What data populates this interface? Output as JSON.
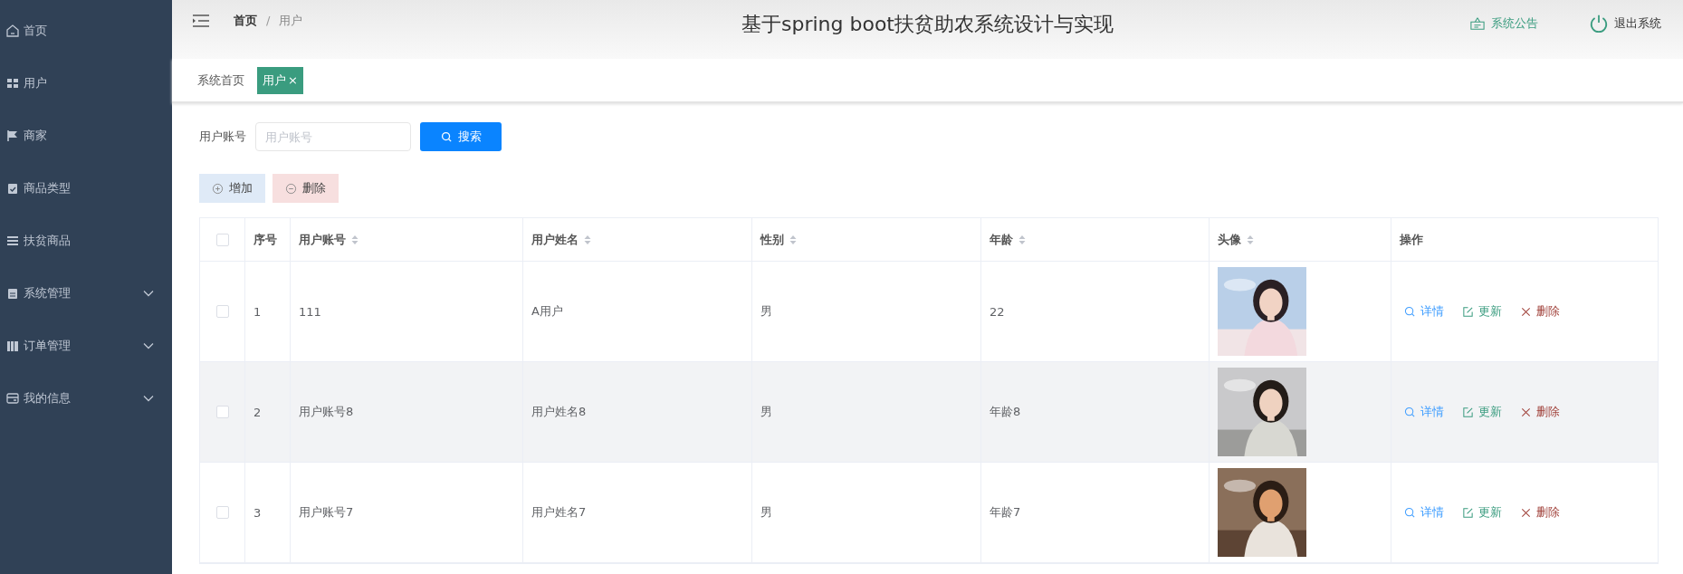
{
  "sidebar": {
    "items": [
      {
        "label": "首页",
        "expandable": false
      },
      {
        "label": "用户",
        "expandable": false
      },
      {
        "label": "商家",
        "expandable": false
      },
      {
        "label": "商品类型",
        "expandable": false
      },
      {
        "label": "扶贫商品",
        "expandable": false
      },
      {
        "label": "系统管理",
        "expandable": true
      },
      {
        "label": "订单管理",
        "expandable": true
      },
      {
        "label": "我的信息",
        "expandable": true
      }
    ]
  },
  "header": {
    "breadcrumb": [
      "首页",
      "用户"
    ],
    "separator": "/",
    "title": "基于spring boot扶贫助农系统设计与实现",
    "actions": [
      {
        "label": "系统公告",
        "kind": "notice"
      },
      {
        "label": "退出系统",
        "kind": "logout"
      }
    ]
  },
  "tabs": [
    {
      "label": "系统首页",
      "selected": false,
      "closable": false
    },
    {
      "label": "用户",
      "selected": true,
      "closable": true,
      "close": "×"
    }
  ],
  "search": {
    "label": "用户账号",
    "placeholder": "用户账号",
    "button": "搜索"
  },
  "toolbar": [
    {
      "label": "增加",
      "kind": "add"
    },
    {
      "label": "删除",
      "kind": "delete"
    }
  ],
  "table": {
    "all_checked": false,
    "columns": [
      {
        "label": "序号",
        "sortable": false
      },
      {
        "label": "用户账号",
        "sortable": true
      },
      {
        "label": "用户姓名",
        "sortable": true
      },
      {
        "label": "性别",
        "sortable": true
      },
      {
        "label": "年龄",
        "sortable": true
      },
      {
        "label": "头像",
        "sortable": true
      },
      {
        "label": "操作",
        "sortable": false
      }
    ],
    "rows": [
      {
        "checked": false,
        "highlighted": false,
        "index": "1",
        "account": "111",
        "name": "A用户",
        "gender": "男",
        "age": "22",
        "actions": [
          {
            "label": "详情",
            "kind": "detail"
          },
          {
            "label": "更新",
            "kind": "edit"
          },
          {
            "label": "删除",
            "kind": "delete"
          }
        ]
      },
      {
        "checked": false,
        "highlighted": true,
        "index": "2",
        "account": "用户账号8",
        "name": "用户姓名8",
        "gender": "男",
        "age": "年龄8",
        "actions": [
          {
            "label": "详情",
            "kind": "detail"
          },
          {
            "label": "更新",
            "kind": "edit"
          },
          {
            "label": "删除",
            "kind": "delete"
          }
        ]
      },
      {
        "checked": false,
        "highlighted": false,
        "index": "3",
        "account": "用户账号7",
        "name": "用户姓名7",
        "gender": "男",
        "age": "年龄7",
        "actions": [
          {
            "label": "详情",
            "kind": "detail"
          },
          {
            "label": "更新",
            "kind": "edit"
          },
          {
            "label": "删除",
            "kind": "delete"
          }
        ]
      }
    ]
  }
}
